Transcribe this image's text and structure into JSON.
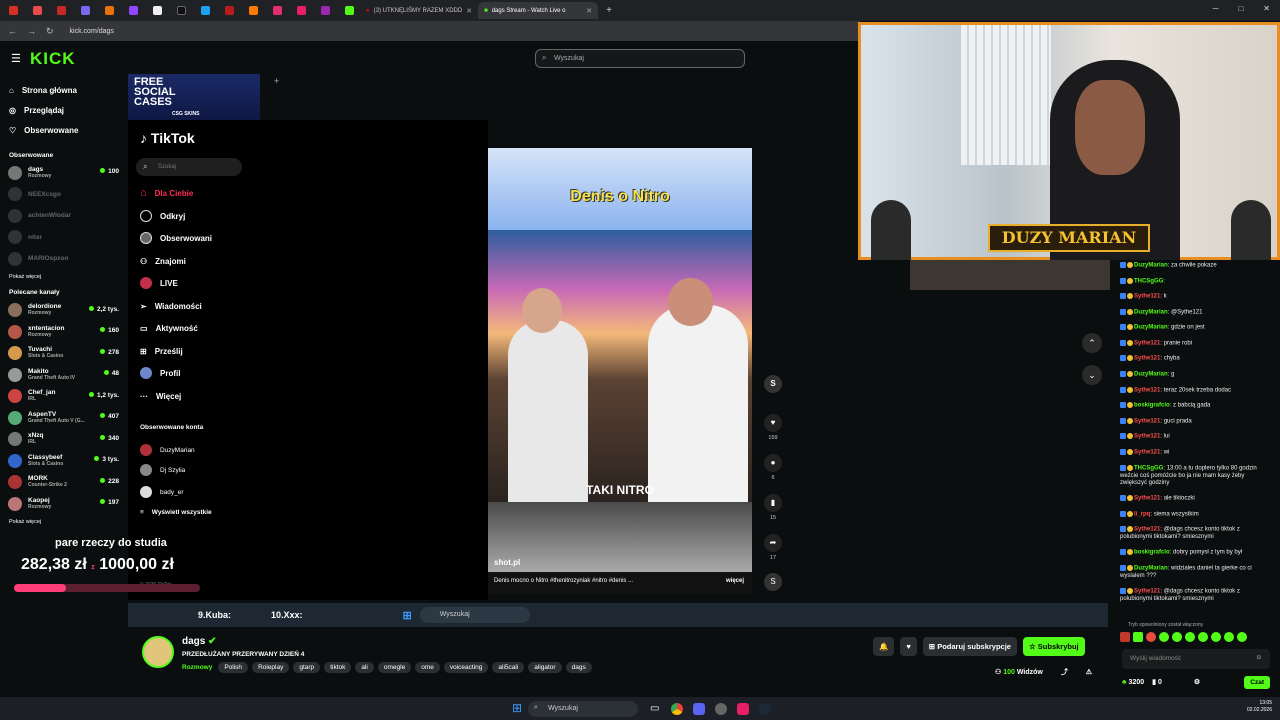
{
  "browser": {
    "tabs": [
      {
        "label": "(3) UTKNĘLIŚMY RAZEM XDDD"
      },
      {
        "label": "dags Stream - Watch Live o"
      }
    ],
    "url": "kick.com/dags"
  },
  "kick": {
    "logo": "KICK",
    "search_placeholder": "Wyszukaj",
    "nav": [
      {
        "label": "Strona główna"
      },
      {
        "label": "Przeglądaj"
      },
      {
        "label": "Obserwowane"
      }
    ],
    "followed_title": "Obserwowane",
    "followed": [
      {
        "name": "dags",
        "cat": "Rozmowy",
        "viewers": "100",
        "online": true
      },
      {
        "name": "NEEXcsgo",
        "online": false
      },
      {
        "name": "achtenWlodar",
        "online": false
      },
      {
        "name": "niter",
        "online": false
      },
      {
        "name": "MARIOspzoo",
        "online": false
      }
    ],
    "show_more": "Pokaż więcej",
    "recommended_title": "Polecane kanały",
    "recommended": [
      {
        "name": "delordione",
        "cat": "Rozmowy",
        "viewers": "2,2 tys."
      },
      {
        "name": "xntentacion",
        "cat": "Rozmowy",
        "viewers": "160"
      },
      {
        "name": "Tuvachi",
        "cat": "Slots & Casino",
        "viewers": "278"
      },
      {
        "name": "Makito",
        "cat": "Grand Theft Auto IV",
        "viewers": "48"
      },
      {
        "name": "Chef_jan",
        "cat": "IRL",
        "viewers": "1,2 tys."
      },
      {
        "name": "AspenTV",
        "cat": "Grand Theft Auto V (G...",
        "viewers": "407"
      },
      {
        "name": "xNzq",
        "cat": "IRL",
        "viewers": "340"
      },
      {
        "name": "Classybeef",
        "cat": "Slots & Casino",
        "viewers": "3 tys."
      },
      {
        "name": "MORK",
        "cat": "Counter-Strike 2",
        "viewers": "228"
      },
      {
        "name": "Kaopej",
        "cat": "Rozmowy",
        "viewers": "197"
      }
    ],
    "show_more2": "Pokaż więcej"
  },
  "banner": {
    "line1": "FREE",
    "line2": "SOCIAL",
    "line3": "CASES",
    "brand": "CSG SKINS"
  },
  "tiktok": {
    "logo": "TikTok",
    "search": "Szukaj",
    "nav": [
      {
        "label": "Dla Ciebie"
      },
      {
        "label": "Odkryj"
      },
      {
        "label": "Obserwowani"
      },
      {
        "label": "Znajomi"
      },
      {
        "label": "LIVE"
      },
      {
        "label": "Wiadomości"
      },
      {
        "label": "Aktywność"
      },
      {
        "label": "Prześlij"
      },
      {
        "label": "Profil"
      },
      {
        "label": "Więcej"
      }
    ],
    "followed_title": "Obserwowane konta",
    "followed": [
      {
        "name": "DuzyMarian"
      },
      {
        "name": "Dj Szylia"
      },
      {
        "name": "bady_er"
      }
    ],
    "show_all": "Wyświetl wszystkie",
    "footer": "© 2026 TikTok",
    "video": {
      "title": "Denis o Nitro",
      "caption": "TAKI NITRO",
      "source": "shot.pl",
      "desc": "Denis mocno o Nitro #thenitrozyniak #nitro #denis ...",
      "more": "więcej",
      "likes": "159",
      "comments": "6",
      "saves": "15",
      "shares": "17"
    }
  },
  "overlay": {
    "studio": "pare rzeczy do studia",
    "current": "282,38 zł",
    "sep": "z",
    "target": "1000,00 zł",
    "progress": 0.28,
    "ranking": [
      {
        "label": "9.Kuba:"
      },
      {
        "label": "10.Xxx:"
      }
    ]
  },
  "webcam": {
    "name": "DUZY MARIAN"
  },
  "chat": {
    "messages": [
      {
        "user": "DuzyMarian",
        "color": "#53fc18",
        "text": "za chwile pokaze"
      },
      {
        "user": "THCSgGG",
        "color": "#53fc18",
        "text": ""
      },
      {
        "user": "Sythe121",
        "color": "#ff4d4d",
        "text": "k"
      },
      {
        "user": "DuzyMarian",
        "color": "#53fc18",
        "text": "@Sythe121"
      },
      {
        "user": "DuzyMarian",
        "color": "#53fc18",
        "text": "gdzie on jest"
      },
      {
        "user": "Sythe121",
        "color": "#ff4d4d",
        "text": "pranie robi"
      },
      {
        "user": "Sythe121",
        "color": "#ff4d4d",
        "text": "chyba"
      },
      {
        "user": "DuzyMarian",
        "color": "#53fc18",
        "text": "g"
      },
      {
        "user": "Sythe121",
        "color": "#ff4d4d",
        "text": "teraz 20sek trzeba dodac"
      },
      {
        "user": "boskigrafcio",
        "color": "#53fc18",
        "text": "z babcią gada"
      },
      {
        "user": "Sythe121",
        "color": "#ff4d4d",
        "text": "guci prada"
      },
      {
        "user": "Sythe121",
        "color": "#ff4d4d",
        "text": "lui"
      },
      {
        "user": "Sythe121",
        "color": "#ff4d4d",
        "text": "wi"
      },
      {
        "user": "THCSgGG",
        "color": "#53fc18",
        "text": "13:00 a tu doplero tylko 80 godzin weźcie coś pomóżcie bo ja nie mam kasy żeby zwiększyć godziny"
      },
      {
        "user": "Sythe121",
        "color": "#ff4d4d",
        "text": "ale tiktoczki"
      },
      {
        "user": "li_rpq",
        "color": "#ff4d4d",
        "text": "siema wszystkim"
      },
      {
        "user": "Sythe121",
        "color": "#ff4d4d",
        "text": "@dags chcesz konto tiktok z polubionymi tiktokami? smiesznymi"
      },
      {
        "user": "boskigrafcio",
        "color": "#53fc18",
        "text": "dobry pomysł z tym by był"
      },
      {
        "user": "DuzyMarian",
        "color": "#53fc18",
        "text": "widziales daniel ta gierke co ci wyslalem ???"
      },
      {
        "user": "Sythe121",
        "color": "#ff4d4d",
        "text": "@dags chcesz konto tiktok z polubionymi tiktokami? smiesznymi"
      }
    ],
    "slow_mode": "Tryb spowolniony został włączony",
    "input_placeholder": "Wyślij wiadomość",
    "points": "3200",
    "badge_count": "0",
    "send": "Czat"
  },
  "stream": {
    "name": "dags",
    "title": "PRZEDŁUŻANY PRZERYWANY DZIEŃ 4",
    "category": "Rozmowy",
    "tags": [
      "Polish",
      "Roleplay",
      "gtarp",
      "tiktok",
      "ali",
      "omegle",
      "ome",
      "voiceacting",
      "ali5cali",
      "aligator",
      "dags"
    ],
    "subscribe_gift": "Podaruj subskrypcje",
    "subscribe": "Subskrybuj",
    "viewers": "100",
    "viewers_label": "Widzów"
  },
  "taskbar": {
    "search": "Wyszukaj",
    "time": "13:05",
    "date": "02.02.2026"
  }
}
